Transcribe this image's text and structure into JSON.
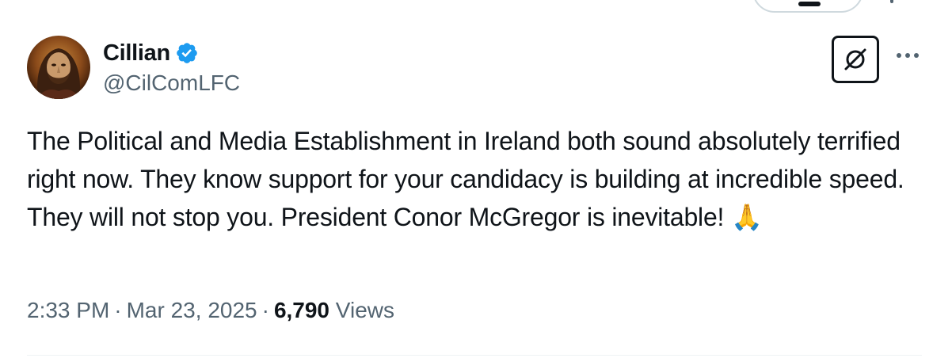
{
  "tweet": {
    "author": {
      "display_name": "Cillian",
      "handle": "@CilComLFC",
      "verified": true,
      "avatar": "avatar-image"
    },
    "text": "The Political and Media Establishment in Ireland both sound absolutely terrified right now. They know support for your candidacy is building at incredible speed. They will not stop you. President Conor McGregor is inevitable!",
    "emoji": "🙏",
    "time": "2:33 PM",
    "separator": "·",
    "date": "Mar 23, 2025",
    "views_count": "6,790",
    "views_label": "Views"
  },
  "icons": {
    "verified": "verified-badge-icon",
    "grok": "grok-icon",
    "more": "more-options-icon"
  },
  "colors": {
    "text_primary": "#0f1419",
    "text_secondary": "#536471",
    "verified_blue": "#1d9bf0",
    "divider": "#eff3f4"
  }
}
